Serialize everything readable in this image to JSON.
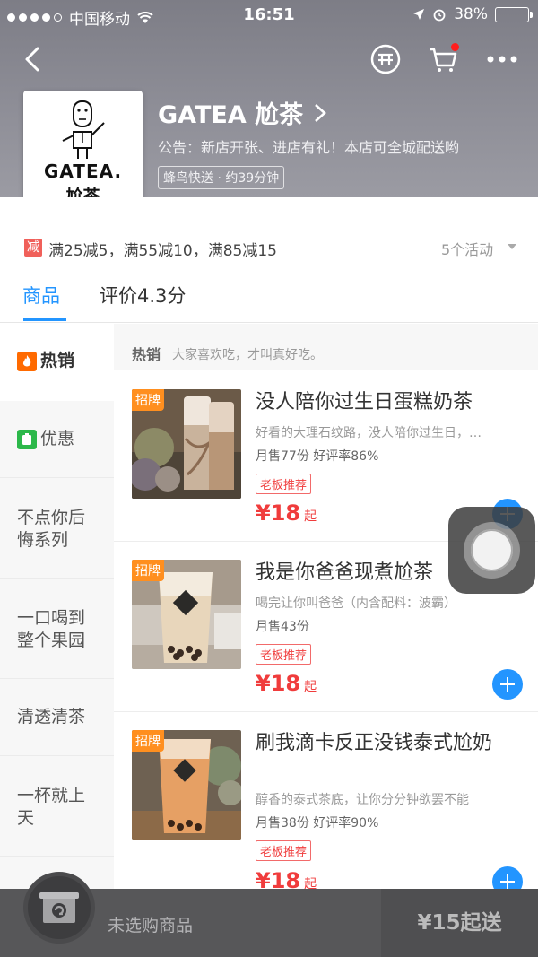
{
  "status_bar": {
    "carrier": "中国移动",
    "time": "16:51",
    "battery": "38%",
    "battery_level": 0.38,
    "signal_icons": [
      "wifi-icon",
      "location-arrow-icon",
      "alarm-icon",
      "battery-icon"
    ]
  },
  "nav": {
    "icons": [
      "back-icon",
      "group-order-icon",
      "cart-icon",
      "more-icon"
    ],
    "cart_has_notification": true
  },
  "shop": {
    "logo_en": "GATEA.",
    "logo_cn": "尬茶",
    "name": "GATEA 尬茶",
    "notice": "公告：新店开张、进店有礼！本店可全城配送哟",
    "delivery": "蜂鸟快送 · 约39分钟"
  },
  "promo": {
    "badge": "减",
    "text": "满25减5，满55减10，满85减15",
    "count": "5个活动"
  },
  "tabs": [
    {
      "label": "商品",
      "active": true
    },
    {
      "label": "评价4.3分",
      "active": false
    }
  ],
  "sidebar": [
    {
      "label": "热销",
      "icon": "flame-icon",
      "active": true
    },
    {
      "label": "优惠",
      "icon": "discount-tag-icon",
      "active": false
    },
    {
      "label": "不点你后悔系列",
      "active": false
    },
    {
      "label": "一口喝到整个果园",
      "active": false
    },
    {
      "label": "清透清茶",
      "active": false
    },
    {
      "label": "一杯就上天",
      "active": false
    }
  ],
  "section": {
    "title": "热销",
    "desc": "大家喜欢吃，才叫真好吃。"
  },
  "products": [
    {
      "badge": "招牌",
      "name": "没人陪你过生日蛋糕奶茶",
      "desc": "好看的大理石纹路，没人陪你过生日，…",
      "sales": "月售77份  好评率86%",
      "tag": "老板推荐",
      "price": "¥18",
      "price_suffix": "起"
    },
    {
      "badge": "招牌",
      "name": "我是你爸爸现煮尬茶",
      "desc": "喝完让你叫爸爸（内含配料：波霸）",
      "sales": "月售43份",
      "tag": "老板推荐",
      "price": "¥18",
      "price_suffix": "起"
    },
    {
      "badge": "招牌",
      "name": "刷我滴卡反正没钱泰式尬奶",
      "desc": "醇香的泰式茶底，让你分分钟欲罢不能",
      "sales": "月售38份  好评率90%",
      "tag": "老板推荐",
      "price": "¥18",
      "price_suffix": "起"
    }
  ],
  "bottom_bar": {
    "cart_text": "未选购商品",
    "min_order": "¥15起送"
  },
  "colors": {
    "accent": "#2395ff",
    "price": "#f03c3c",
    "badge": "#ff8f1f"
  }
}
